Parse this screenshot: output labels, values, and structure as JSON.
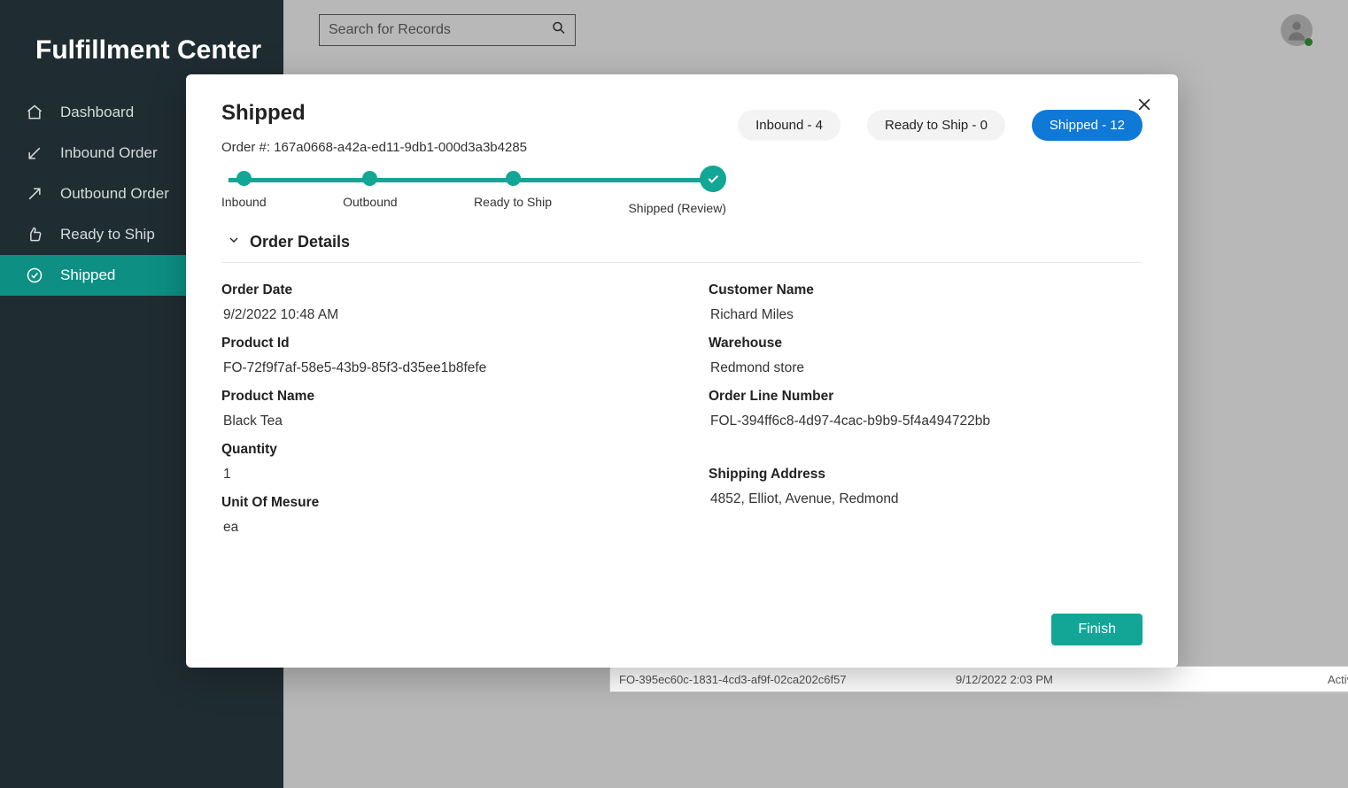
{
  "app_title": "Fulfillment Center",
  "search": {
    "placeholder": "Search for Records"
  },
  "nav": [
    {
      "label": "Dashboard",
      "icon": "home-icon"
    },
    {
      "label": "Inbound Order",
      "icon": "arrow-in-icon"
    },
    {
      "label": "Outbound Order",
      "icon": "arrow-out-icon"
    },
    {
      "label": "Ready to Ship",
      "icon": "thumbs-up-icon"
    },
    {
      "label": "Shipped",
      "icon": "check-circle-icon"
    }
  ],
  "modal": {
    "title": "Shipped",
    "order_label": "Order #: 167a0668-a42a-ed11-9db1-000d3a3b4285",
    "pills": {
      "inbound": "Inbound - 4",
      "ready": "Ready to Ship - 0",
      "shipped": "Shipped - 12"
    },
    "steps": {
      "inbound": "Inbound",
      "outbound": "Outbound",
      "ready": "Ready to Ship",
      "shipped": "Shipped (Review)"
    },
    "section_title": "Order Details",
    "labels": {
      "order_date": "Order Date",
      "customer_name": "Customer Name",
      "product_id": "Product Id",
      "warehouse": "Warehouse",
      "product_name": "Product Name",
      "order_line_number": "Order Line Number",
      "quantity": "Quantity",
      "shipping_address": "Shipping Address",
      "unit_of_measure": "Unit Of Mesure"
    },
    "values": {
      "order_date": "9/2/2022 10:48 AM",
      "customer_name": "Richard Miles",
      "product_id": "FO-72f9f7af-58e5-43b9-85f3-d35ee1b8fefe",
      "warehouse": "Redmond store",
      "product_name": "Black Tea",
      "order_line_number": "FOL-394ff6c8-4d97-4cac-b9b9-5f4a494722bb",
      "quantity": "1",
      "shipping_address": "4852, Elliot, Avenue, Redmond",
      "unit_of_measure": "ea"
    },
    "finish_button": "Finish"
  },
  "bg_row": {
    "c1": "FO-395ec60c-1831-4cd3-af9f-02ca202c6f57",
    "c2": "9/12/2022 2:03 PM",
    "c3": "Active"
  }
}
